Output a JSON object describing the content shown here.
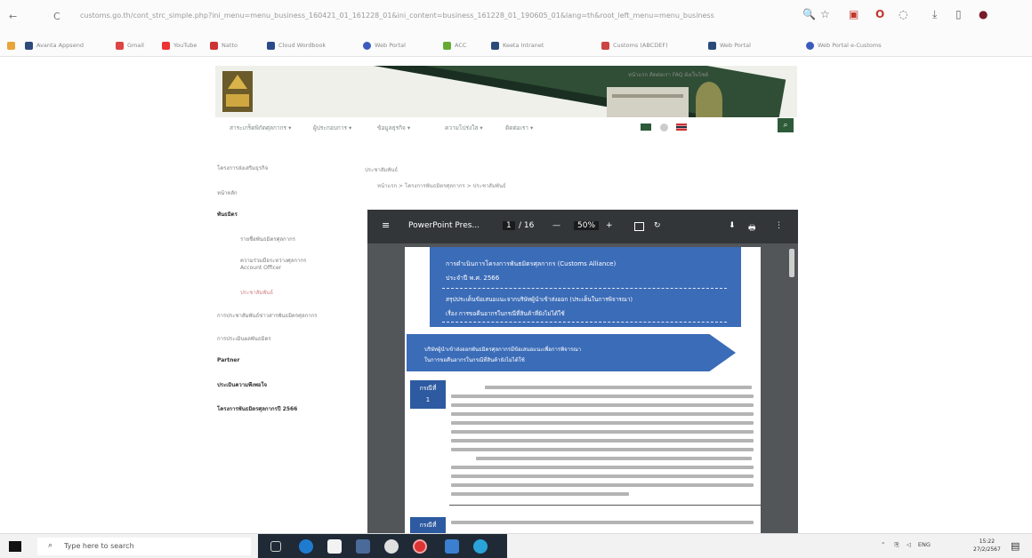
{
  "browser": {
    "url": "customs.go.th/cont_strc_simple.php?ini_menu=menu_business_160421_01_161228_01&ini_content=business_161228_01_190605_01&lang=th&root_left_menu=menu_business",
    "nav_back": "←",
    "nav_reload": "C",
    "bookmarks": [
      "Avanta Appsend",
      "Gmail",
      "YouTube",
      "Natto",
      "Cloud Wordbook",
      "Web Portal",
      "ACC",
      "Keeta Intranet",
      "Customs (ABCDEF)",
      "Web Portal",
      "Web Portal e-Customs"
    ]
  },
  "site": {
    "top_links": "หน้าแรก  ติดต่อเรา  FAQ  ผังเว็บไซต์",
    "nav": [
      "สาระเกร็ดพิกัดศุลกากร ▾",
      "ผู้ประกอบการ ▾",
      "ข้อมูลธุรกิจ ▾",
      "ความโปร่งใส ▾",
      "ติดต่อเรา ▾"
    ],
    "search_icon": "search-icon"
  },
  "leftmenu": [
    {
      "label": "โครงการส่งเสริมธุรกิจ",
      "style": "normal"
    },
    {
      "label": "หน้าหลัก",
      "style": "normal"
    },
    {
      "label": "พันธมิตร",
      "style": "bold"
    },
    {
      "label": "รายชื่อพันธมิตรศุลกากร",
      "style": "normal"
    },
    {
      "label": "ความร่วมมือระหว่างศุลกากร",
      "style": "normal"
    },
    {
      "label": "Account Officer",
      "style": "normal"
    },
    {
      "label": "ประชาสัมพันธ์",
      "style": "red"
    },
    {
      "label": "การประชาสัมพันธ์ข่าวสารพันธมิตรศุลกากร",
      "style": "normal"
    },
    {
      "label": "การประเมินผลพันธมิตร",
      "style": "normal"
    },
    {
      "label": "Partner",
      "style": "bold"
    },
    {
      "label": "ประเมินความพึงพอใจ",
      "style": "bold"
    },
    {
      "label": "โครงการพันธมิตรศุลกากรปี 2566",
      "style": "bold"
    }
  ],
  "breadcrumb": {
    "line1": "ประชาสัมพันธ์",
    "line2": "หน้าแรก > โครงการพันธมิตรศุลกากร > ประชาสัมพันธ์"
  },
  "viewer": {
    "menu_icon": "≡",
    "title": "PowerPoint Pres...",
    "page": "1",
    "page_total": "/ 16",
    "zoom_out": "—",
    "zoom": "50%",
    "zoom_in": "+",
    "fit_icon": "fit-page-icon",
    "rotate_icon": "↻",
    "download_icon": "⬇",
    "print_icon": "🖶",
    "more_icon": "⋮"
  },
  "pdf": {
    "header_line1": "การดำเนินการโครงการพันธมิตรศุลกากร (Customs Alliance)",
    "header_line2": "ประจำปี พ.ศ. 2566",
    "header_line3": "สรุปประเด็นข้อเสนอแนะจากบริษัทผู้นำเข้าส่งออก (ประเด็นในการพิจารณา)",
    "header_line4": "เรื่อง การขอคืนอากรในกรณีที่สินค้าที่ยังไม่ได้ใช้",
    "arrow_line1": "บริษัทผู้นำเข้าส่งออกพันธมิตรศุลกากรมีข้อเสนอแนะเพื่อการพิจารณา",
    "arrow_line2": "ในการขอคืนอากรในกรณีที่สินค้ายังไม่ได้ใช้",
    "case1_tag": "กรณีที่",
    "case1_num": "1",
    "case2_tag": "กรณีที่"
  },
  "taskbar": {
    "search_placeholder": "Type here to search",
    "tray_lang": "ENG",
    "time": "15:22",
    "date": "27/2/2567"
  }
}
